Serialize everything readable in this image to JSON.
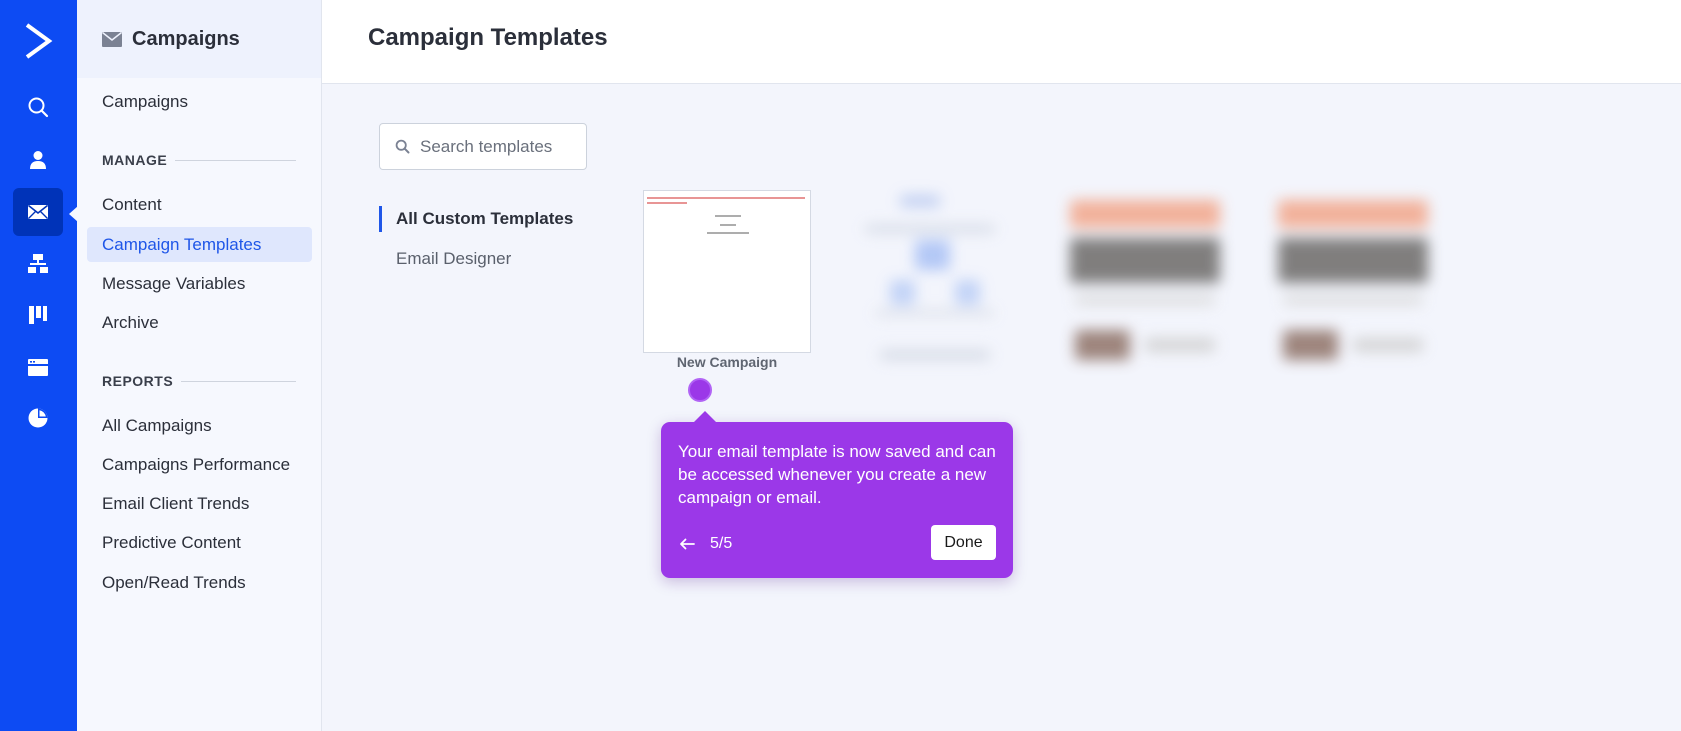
{
  "app": {
    "brand_color": "#0d4bf3",
    "accent_color": "#1f56e8",
    "tour_color": "#9b38e8"
  },
  "rail": {
    "items": [
      {
        "icon": "search-icon"
      },
      {
        "icon": "contacts-icon"
      },
      {
        "icon": "campaigns-mail-icon",
        "active": true
      },
      {
        "icon": "automations-icon"
      },
      {
        "icon": "deals-icon"
      },
      {
        "icon": "website-icon"
      },
      {
        "icon": "reports-icon"
      }
    ]
  },
  "sidebar": {
    "title": "Campaigns",
    "top_link": "Campaigns",
    "manage": {
      "heading": "MANAGE",
      "items": [
        "Content",
        "Campaign Templates",
        "Message Variables",
        "Archive"
      ],
      "active": "Campaign Templates"
    },
    "reports": {
      "heading": "REPORTS",
      "items": [
        "All Campaigns",
        "Campaigns Performance",
        "Email Client Trends",
        "Predictive Content",
        "Open/Read Trends"
      ]
    }
  },
  "header": {
    "title": "Campaign Templates"
  },
  "search": {
    "placeholder": "Search templates",
    "value": ""
  },
  "filters": {
    "items": [
      "All Custom Templates",
      "Email Designer"
    ],
    "active": "All Custom Templates"
  },
  "templates": [
    {
      "name": "New Campaign"
    }
  ],
  "tour": {
    "message": "Your email template is now saved and can be accessed whenever you create a new campaign or email.",
    "step": "5/5",
    "done_label": "Done"
  }
}
